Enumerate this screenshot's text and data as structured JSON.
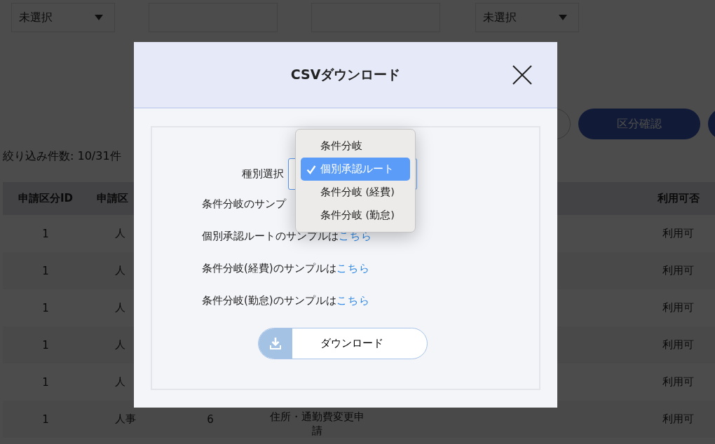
{
  "filters": [
    {
      "kind": "select",
      "value": "未選択"
    },
    {
      "kind": "text"
    },
    {
      "kind": "text"
    },
    {
      "kind": "select",
      "value": "未選択"
    }
  ],
  "action_button": "区分確認",
  "filter_count": "絞り込み件数: 10/31件",
  "table": {
    "columns": {
      "id": "申請区分ID",
      "category": "申請区",
      "availability": "利用可否"
    },
    "rows": [
      {
        "id": "1",
        "category": "人",
        "availability": "利用可"
      },
      {
        "id": "1",
        "category": "人",
        "availability": "利用可"
      },
      {
        "id": "1",
        "category": "人",
        "availability": "利用可"
      },
      {
        "id": "1",
        "category": "人",
        "availability": "利用可"
      },
      {
        "id": "1",
        "category": "人",
        "availability": "利用可"
      },
      {
        "id": "1",
        "category": "人事",
        "column_3": "6",
        "column_4": "住所・通勤費変更申請",
        "availability": "利用可"
      }
    ]
  },
  "modal": {
    "title": "CSVダウンロード",
    "type_label": "種別選択",
    "type_options": [
      {
        "label": "条件分岐",
        "selected": false
      },
      {
        "label": "個別承認ルート",
        "selected": true
      },
      {
        "label": "条件分岐 (経費)",
        "selected": false
      },
      {
        "label": "条件分岐 (勤怠)",
        "selected": false
      }
    ],
    "samples": [
      {
        "text": "条件分岐のサンプ"
      },
      {
        "text": "個別承認ルートのサンプルは",
        "link": "こちら"
      },
      {
        "text": "条件分岐(経費)のサンプルは",
        "link": "こちら"
      },
      {
        "text": "条件分岐(勤怠)のサンプルは",
        "link": "こちら"
      }
    ],
    "download_button": "ダウンロード"
  }
}
